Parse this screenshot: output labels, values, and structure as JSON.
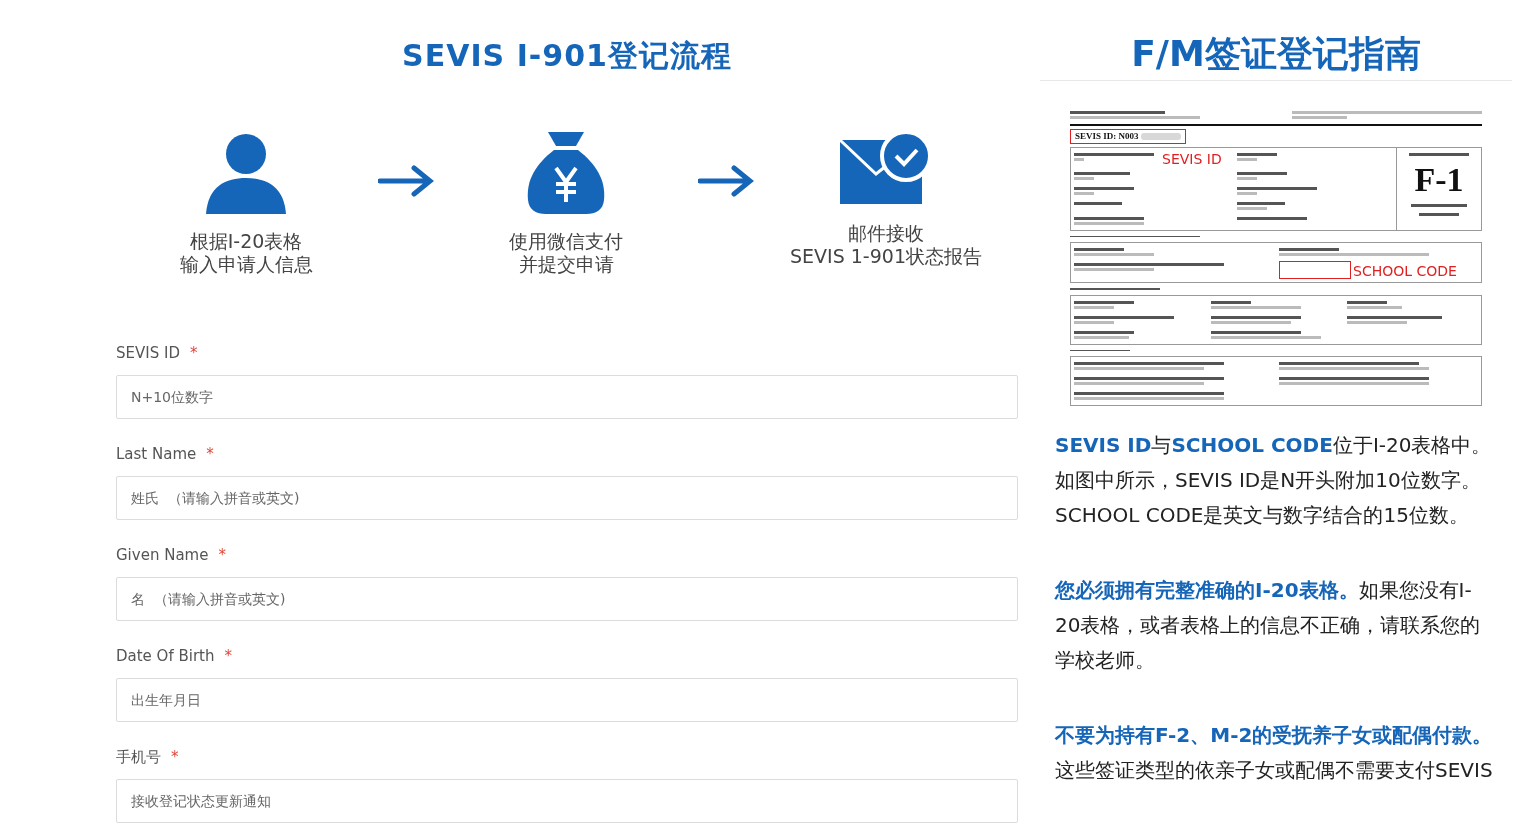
{
  "flow": {
    "title": "SEVIS I-901登记流程",
    "steps": [
      {
        "kind": "person",
        "lines": [
          "根据I-20表格",
          "输入申请人信息"
        ]
      },
      {
        "kind": "money",
        "lines": [
          "使用微信支付",
          "并提交申请"
        ]
      },
      {
        "kind": "mail",
        "lines": [
          "邮件接收",
          "SEVIS 1-901状态报告"
        ]
      }
    ]
  },
  "form": {
    "fields": [
      {
        "label": "SEVIS ID",
        "mark": "*",
        "placeholder": "N+10位数字"
      },
      {
        "label": "Last Name",
        "mark": "*",
        "placeholder": "姓氏  （请输入拼音或英文)"
      },
      {
        "label": "Given Name",
        "mark": "*",
        "placeholder": "名  （请输入拼音或英文)"
      },
      {
        "label": "Date Of Birth",
        "mark": "*",
        "placeholder": "出生年月日"
      },
      {
        "label": "手机号",
        "mark": "*",
        "placeholder": "接收登记状态更新通知"
      }
    ]
  },
  "guide": {
    "title": "F/M签证登记指南",
    "document": {
      "sevis_id": "SEVIS ID:  N003",
      "sevis_callout": "SEVIS ID",
      "class_value": "F-1",
      "school_code_callout": "SCHOOL CODE"
    },
    "paragraphs": [
      "**SEVIS ID**与**SCHOOL CODE**位于I-20表格中。如图中所示，SEVIS ID是N开头附加10位数字。SCHOOL CODE是英文与数字结合的15位数。",
      "**您必须拥有完整准确的I-20表格。**如果您没有I-20表格，或者表格上的信息不正确，请联系您的学校老师。",
      "**不要为持有F-2、M-2的受抚养子女或配偶付款。**这些签证类型的依亲子女或配偶不需要支付SEVIS"
    ]
  }
}
